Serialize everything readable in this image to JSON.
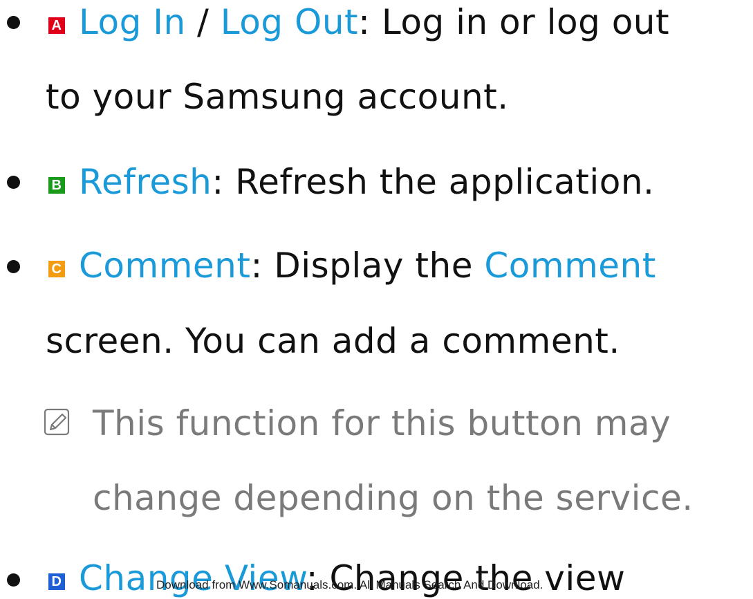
{
  "items": [
    {
      "key": "A",
      "links": [
        "Log In",
        "Log Out"
      ],
      "separator": " / ",
      "text_1": ": Log in or log out",
      "text_2": "to your Samsung account."
    },
    {
      "key": "B",
      "link": "Refresh",
      "text_1": ": Refresh the application."
    },
    {
      "key": "C",
      "link": "Comment",
      "text_1a": ": Display the ",
      "link_2": "Comment",
      "text_2": "screen. You can add a comment."
    },
    {
      "key": "D",
      "link": "Change View",
      "text_1": ": Change the view"
    }
  ],
  "note": {
    "icon": "note-pencil-icon",
    "line_1": "This function for this button may",
    "line_2": "change depending on the service."
  },
  "colors": {
    "link": "#1a9ad8",
    "note_text": "#7a7a7a",
    "key_a": "#e1001a",
    "key_b": "#1a9a1a",
    "key_c": "#f39c12",
    "key_d": "#1f5fd6"
  },
  "footer": {
    "watermark": "Download from Www.Somanuals.com. All Manuals Search And Download."
  }
}
